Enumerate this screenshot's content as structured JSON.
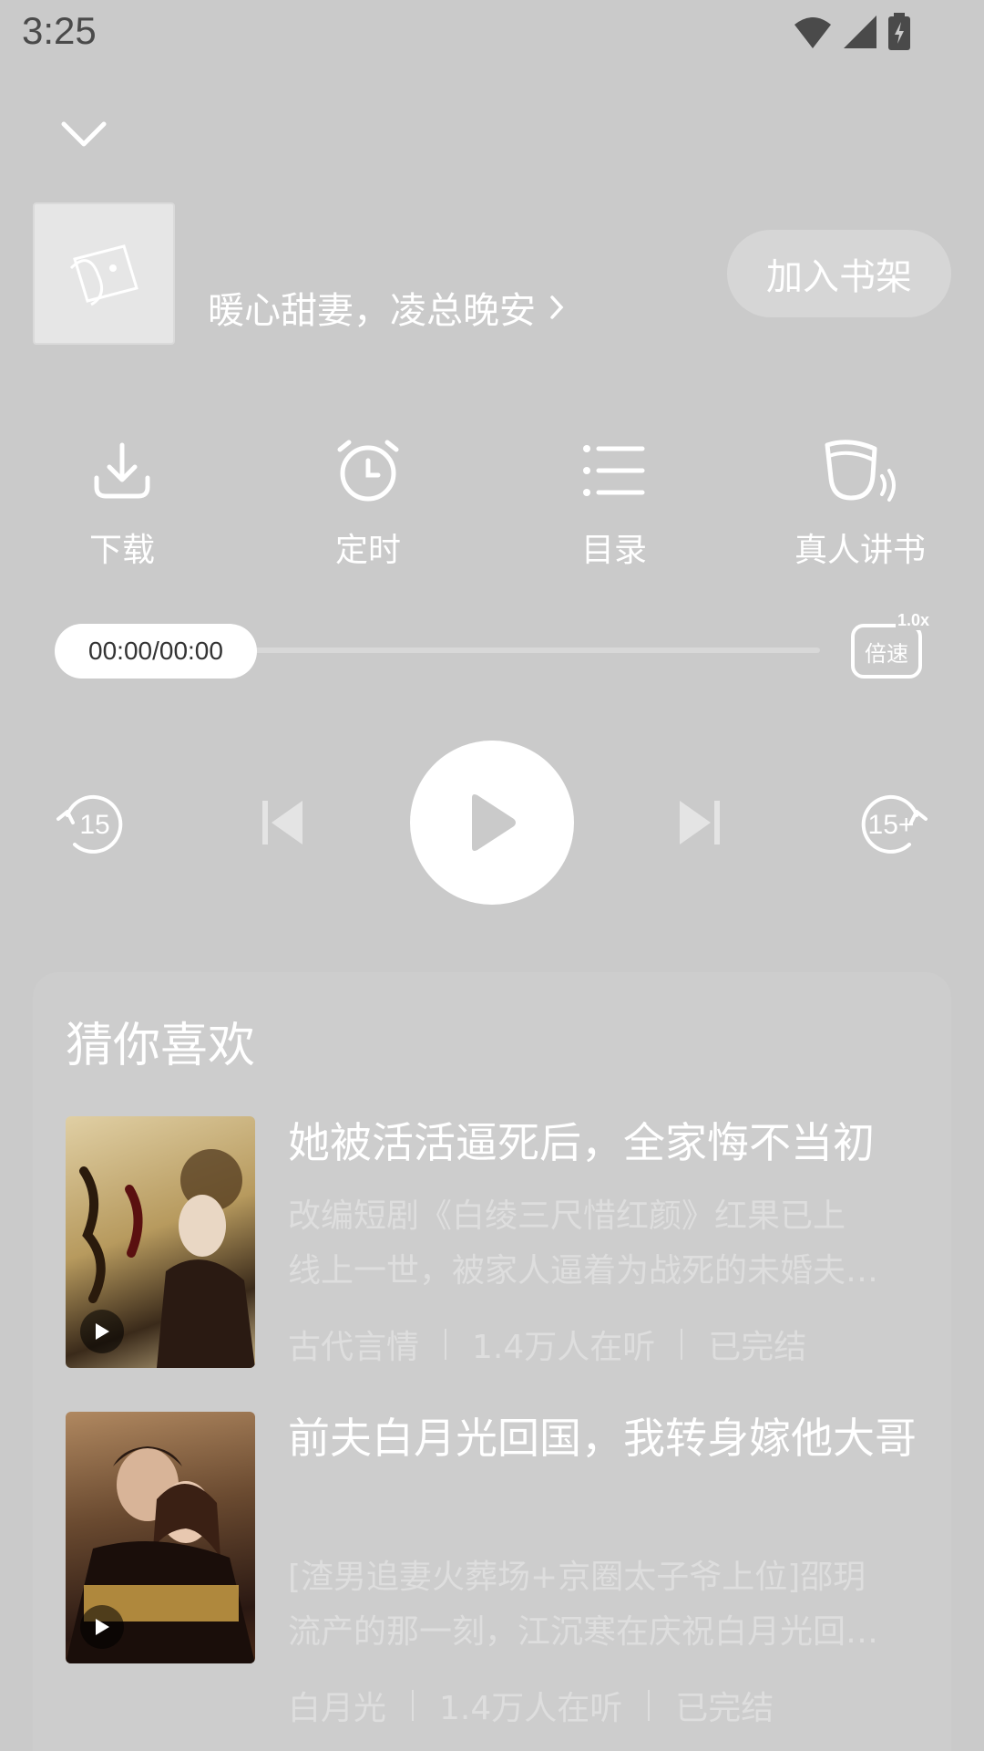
{
  "status_bar": {
    "time": "3:25"
  },
  "book": {
    "title": "暖心甜妻，凌总晚安",
    "title_chevron": "›"
  },
  "header": {
    "shelf_button": "加入书架"
  },
  "functions": [
    {
      "label": "下载",
      "icon": "download-icon"
    },
    {
      "label": "定时",
      "icon": "alarm-clock-icon"
    },
    {
      "label": "目录",
      "icon": "list-icon"
    },
    {
      "label": "真人讲书",
      "icon": "headset-icon"
    }
  ],
  "player": {
    "time_display": "00:00/00:00",
    "progress": 0,
    "speed_label": "倍速",
    "speed_value": "1.0x",
    "rewind_label": "15",
    "forward_label": "15+"
  },
  "recommend": {
    "title": "猜你喜欢",
    "items": [
      {
        "name": "她被活活逼死后，全家悔不当初",
        "desc_line1": "改编短剧《白绫三尺惜红颜》红果已上",
        "desc_line2": "线上一世，被家人逼着为战死的未婚夫…",
        "category": "古代言情",
        "listeners": "1.4万人在听",
        "status": "已完结",
        "cover_colors": [
          "#d9c9a0",
          "#7a5a2a"
        ]
      },
      {
        "name": "前夫白月光回国，我转身嫁他大哥",
        "desc_line1": "[渣男追妻火葬场+京圈太子爷上位]邵玥",
        "desc_line2": "流产的那一刻，江沉寒在庆祝白月光回…",
        "category": "白月光",
        "listeners": "1.4万人在听",
        "status": "已完结",
        "cover_colors": [
          "#a07850",
          "#3a2218"
        ]
      }
    ]
  },
  "colors": {
    "background": "#cacaca",
    "card": "#cdcdcd",
    "text": "#ffffff"
  }
}
